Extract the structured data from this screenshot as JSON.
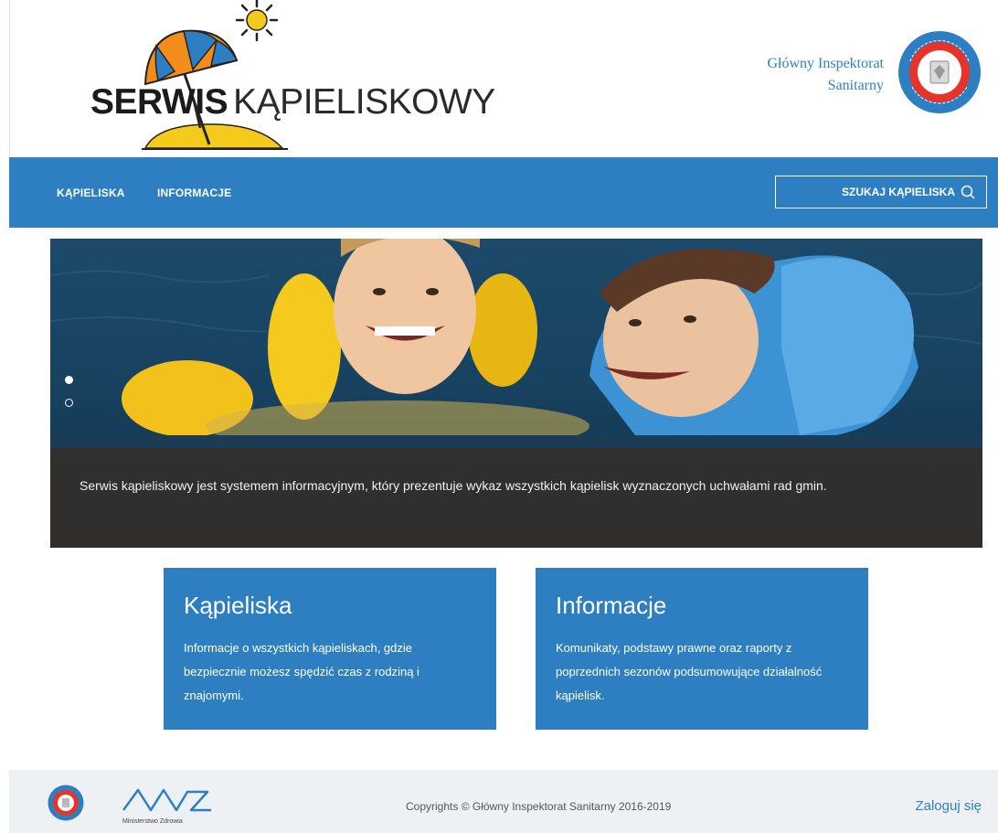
{
  "header": {
    "logo_bold": "SERWIS",
    "logo_light": "KĄPIELISKOWY",
    "org_line1": "Główny Inspektorat",
    "org_line2": "Sanitarny"
  },
  "nav": {
    "items": [
      "KĄPIELISKA",
      "INFORMACJE"
    ],
    "search_label": "SZUKAJ KĄPIELISKA"
  },
  "hero": {
    "caption": "Serwis kąpieliskowy jest systemem informacyjnym, który prezentuje wykaz wszystkich kąpielisk wyznaczonych uchwałami rad gmin.",
    "slides": 2,
    "active_slide": 1
  },
  "cards": [
    {
      "title": "Kąpieliska",
      "text": "Informacje o wszystkich kąpieliskach, gdzie bezpiecznie możesz spędzić czas z rodziną i znajomymi."
    },
    {
      "title": "Informacje",
      "text": "Komunikaty, podstawy prawne oraz raporty z poprzednich sezonów podsumowujące działalność kąpielisk."
    }
  ],
  "footer": {
    "ministry_label": "Ministerstwo Zdrowia",
    "copyright": "Copyrights © Główny Inspektorat Sanitarny 2016-2019",
    "login": "Zaloguj się"
  },
  "colors": {
    "brand_blue": "#2d7fc1",
    "caption_bg": "#342f29",
    "footer_bg": "#eef1f4"
  },
  "icons": [
    "umbrella-icon",
    "sun-icon",
    "search-icon",
    "gis-seal-icon",
    "mz-logo-icon"
  ]
}
